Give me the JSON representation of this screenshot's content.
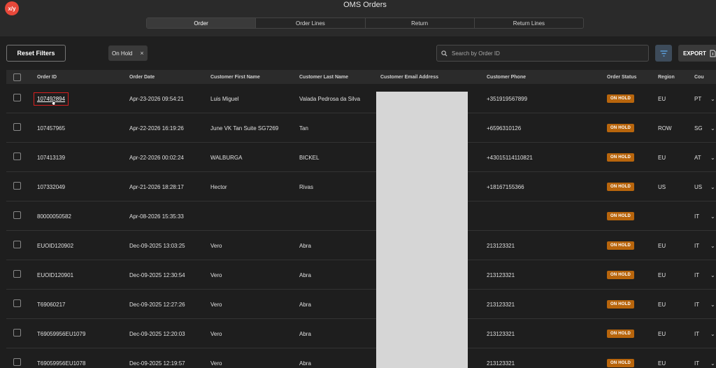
{
  "app": {
    "logo_text": "x/y",
    "title": "OMS Orders"
  },
  "tabs": [
    {
      "label": "Order",
      "active": true
    },
    {
      "label": "Order Lines",
      "active": false
    },
    {
      "label": "Return",
      "active": false
    },
    {
      "label": "Return Lines",
      "active": false
    }
  ],
  "toolbar": {
    "reset_label": "Reset Filters",
    "chip_label": "On Hold",
    "chip_close": "×",
    "search_placeholder": "Search by Order ID",
    "export_label": "EXPORT"
  },
  "table": {
    "headers": {
      "order_id": "Order ID",
      "order_date": "Order Date",
      "first_name": "Customer First Name",
      "last_name": "Customer Last Name",
      "email": "Customer Email Address",
      "phone": "Customer Phone",
      "status": "Order Status",
      "region": "Region",
      "country": "Cou"
    },
    "rows": [
      {
        "order_id": "107492894",
        "date": "Apr-23-2026 09:54:21",
        "first": "Luis Miguel",
        "last": "Valada Pedrosa da Silva",
        "phone": "+351919567899",
        "status": "ON HOLD",
        "region": "EU",
        "country": "PT"
      },
      {
        "order_id": "107457965",
        "date": "Apr-22-2026 16:19:26",
        "first": "June VK Tan Suite SG7269",
        "last": "Tan",
        "phone": "+6596310126",
        "status": "ON HOLD",
        "region": "ROW",
        "country": "SG"
      },
      {
        "order_id": "107413139",
        "date": "Apr-22-2026 00:02:24",
        "first": "WALBURGA",
        "last": "BICKEL",
        "phone": "+43015114110821",
        "status": "ON HOLD",
        "region": "EU",
        "country": "AT"
      },
      {
        "order_id": "107332049",
        "date": "Apr-21-2026 18:28:17",
        "first": "Hector",
        "last": "Rivas",
        "phone": "+18167155366",
        "status": "ON HOLD",
        "region": "US",
        "country": "US"
      },
      {
        "order_id": "80000050582",
        "date": "Apr-08-2026 15:35:33",
        "first": "",
        "last": "",
        "phone": "",
        "status": "ON HOLD",
        "region": "",
        "country": "IT"
      },
      {
        "order_id": "EUOID120902",
        "date": "Dec-09-2025 13:03:25",
        "first": "Vero",
        "last": "Abra",
        "phone": "213123321",
        "status": "ON HOLD",
        "region": "EU",
        "country": "IT"
      },
      {
        "order_id": "EUOID120901",
        "date": "Dec-09-2025 12:30:54",
        "first": "Vero",
        "last": "Abra",
        "phone": "213123321",
        "status": "ON HOLD",
        "region": "EU",
        "country": "IT"
      },
      {
        "order_id": "T69060217",
        "date": "Dec-09-2025 12:27:26",
        "first": "Vero",
        "last": "Abra",
        "phone": "213123321",
        "status": "ON HOLD",
        "region": "EU",
        "country": "IT"
      },
      {
        "order_id": "T69059956EU1079",
        "date": "Dec-09-2025 12:20:03",
        "first": "Vero",
        "last": "Abra",
        "phone": "213123321",
        "status": "ON HOLD",
        "region": "EU",
        "country": "IT"
      },
      {
        "order_id": "T69059956EU1078",
        "date": "Dec-09-2025 12:19:57",
        "first": "Vero",
        "last": "Abra",
        "phone": "213123321",
        "status": "ON HOLD",
        "region": "EU",
        "country": "IT"
      }
    ]
  },
  "colors": {
    "accent": "#e8483a",
    "status_on_hold": "#b8650c",
    "highlight": "#d82020"
  }
}
